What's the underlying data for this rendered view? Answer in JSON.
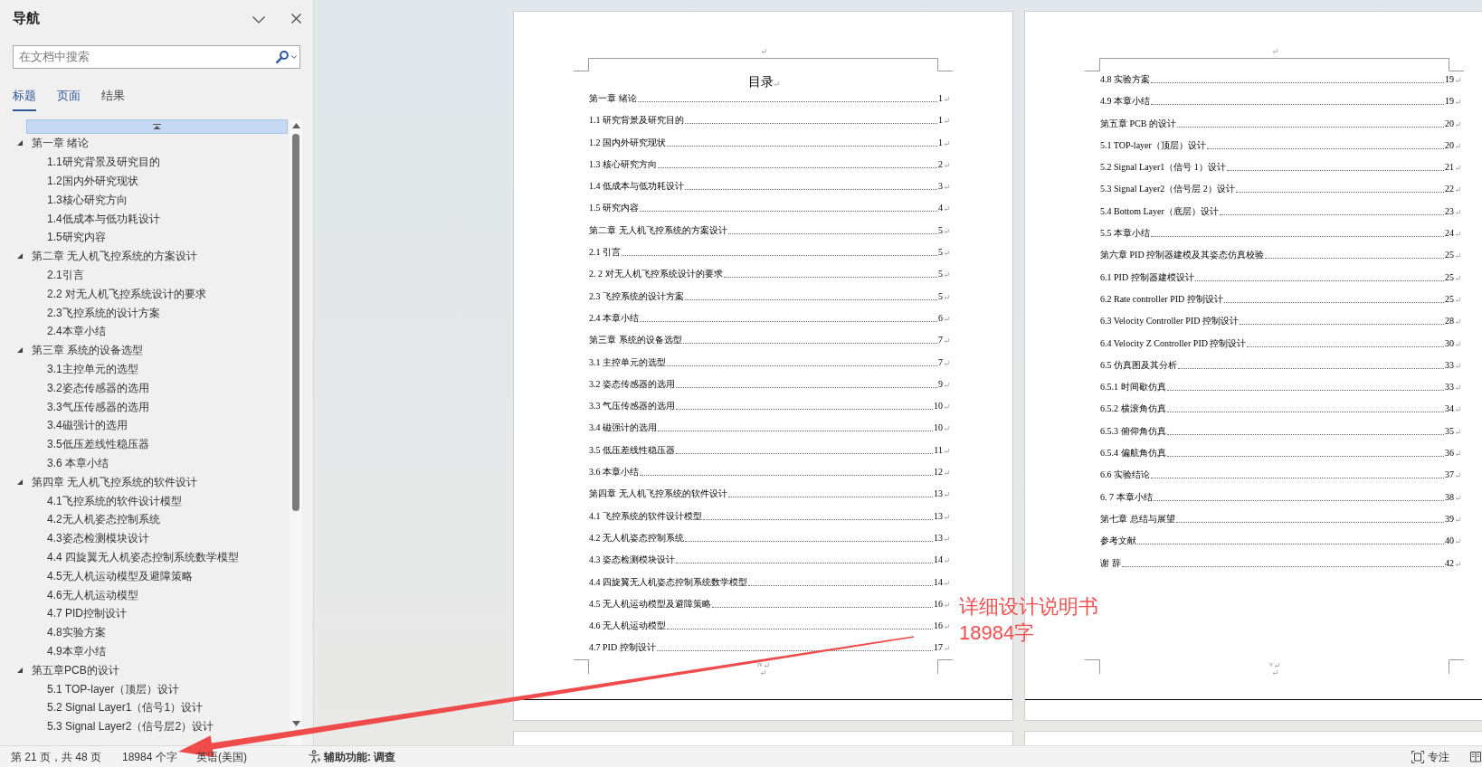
{
  "navigation": {
    "title": "导航",
    "search": {
      "placeholder": "在文档中搜索"
    },
    "tabs": [
      {
        "label": "标题",
        "selected": true,
        "disabled": false
      },
      {
        "label": "页面",
        "selected": false,
        "disabled": false
      },
      {
        "label": "结果",
        "selected": false,
        "disabled": true
      }
    ],
    "headings": [
      {
        "label": "第一章 绪论",
        "expanded": true,
        "children": [
          {
            "label": "1.1研究背景及研究目的"
          },
          {
            "label": "1.2国内外研究现状"
          },
          {
            "label": "1.3核心研究方向"
          },
          {
            "label": "1.4低成本与低功耗设计"
          },
          {
            "label": "1.5研究内容"
          }
        ]
      },
      {
        "label": "第二章 无人机飞控系统的方案设计",
        "expanded": true,
        "children": [
          {
            "label": "2.1引言"
          },
          {
            "label": "2.2 对无人机飞控系统设计的要求"
          },
          {
            "label": "2.3飞控系统的设计方案"
          },
          {
            "label": "2.4本章小结"
          }
        ]
      },
      {
        "label": "第三章 系统的设备选型",
        "expanded": true,
        "children": [
          {
            "label": "3.1主控单元的选型"
          },
          {
            "label": "3.2姿态传感器的选用"
          },
          {
            "label": "3.3气压传感器的选用"
          },
          {
            "label": "3.4磁强计的选用"
          },
          {
            "label": "3.5低压差线性稳压器"
          },
          {
            "label": "3.6 本章小结"
          }
        ]
      },
      {
        "label": "第四章 无人机飞控系统的软件设计",
        "expanded": true,
        "children": [
          {
            "label": "4.1飞控系统的软件设计模型"
          },
          {
            "label": "4.2无人机姿态控制系统"
          },
          {
            "label": "4.3姿态检测模块设计"
          },
          {
            "label": "4.4 四旋翼无人机姿态控制系统数学模型"
          },
          {
            "label": "4.5无人机运动模型及避障策略"
          },
          {
            "label": "4.6无人机运动模型"
          },
          {
            "label": "4.7 PID控制设计"
          },
          {
            "label": "4.8实验方案"
          },
          {
            "label": "4.9本章小结"
          }
        ]
      },
      {
        "label": "第五章PCB的设计",
        "expanded": true,
        "children": [
          {
            "label": "5.1 TOP-layer（顶层）设计"
          },
          {
            "label": "5.2 Signal Layer1（信号1）设计"
          },
          {
            "label": "5.3 Signal Layer2（信号层2）设计"
          }
        ]
      }
    ]
  },
  "document": {
    "pages": [
      {
        "title": "目录",
        "entries": [
          {
            "title": "第一章 绪论",
            "page": "1"
          },
          {
            "title": "1.1 研究背景及研究目的",
            "page": "1"
          },
          {
            "title": "1.2 国内外研究现状",
            "page": "1"
          },
          {
            "title": "1.3 核心研究方向",
            "page": "2"
          },
          {
            "title": "1.4 低成本与低功耗设计",
            "page": "3"
          },
          {
            "title": "1.5 研究内容",
            "page": "4"
          },
          {
            "title": "第二章 无人机飞控系统的方案设计",
            "page": "5"
          },
          {
            "title": "2.1 引言",
            "page": "5"
          },
          {
            "title": "2. 2 对无人机飞控系统设计的要求",
            "page": "5"
          },
          {
            "title": "2.3 飞控系统的设计方案",
            "page": "5"
          },
          {
            "title": "2.4 本章小结",
            "page": "6"
          },
          {
            "title": "第三章 系统的设备选型",
            "page": "7"
          },
          {
            "title": "3.1 主控单元的选型",
            "page": "7"
          },
          {
            "title": "3.2 姿态传感器的选用",
            "page": "9"
          },
          {
            "title": "3.3 气压传感器的选用",
            "page": "10"
          },
          {
            "title": "3.4 磁强计的选用",
            "page": "10"
          },
          {
            "title": "3.5 低压差线性稳压器",
            "page": "11"
          },
          {
            "title": "3.6 本章小结",
            "page": "12"
          },
          {
            "title": "第四章 无人机飞控系统的软件设计",
            "page": "13"
          },
          {
            "title": "4.1 飞控系统的软件设计模型",
            "page": "13"
          },
          {
            "title": "4.2 无人机姿态控制系统",
            "page": "13"
          },
          {
            "title": "4.3 姿态检测模块设计",
            "page": "14"
          },
          {
            "title": "4.4 四旋翼无人机姿态控制系统数学模型",
            "page": "14"
          },
          {
            "title": "4.5 无人机运动模型及避障策略",
            "page": "16"
          },
          {
            "title": "4.6 无人机运动模型",
            "page": "16"
          },
          {
            "title": "4.7 PID 控制设计",
            "page": "17"
          }
        ],
        "page_number": "iv"
      },
      {
        "entries": [
          {
            "title": "4.8 实验方案",
            "page": "19"
          },
          {
            "title": "4.9 本章小结",
            "page": "19"
          },
          {
            "title": "第五章 PCB 的设计",
            "page": "20"
          },
          {
            "title": "5.1 TOP-layer（顶层）设计",
            "page": "20"
          },
          {
            "title": "5.2 Signal Layer1（信号 1）设计",
            "page": "21"
          },
          {
            "title": "5.3 Signal Layer2（信号层 2）设计",
            "page": "22"
          },
          {
            "title": "5.4 Bottom Layer（底层）设计",
            "page": "23"
          },
          {
            "title": "5.5 本章小结",
            "page": "24"
          },
          {
            "title": "第六章 PID 控制器建模及其姿态仿真校验",
            "page": "25"
          },
          {
            "title": "6.1 PID 控制器建模设计",
            "page": "25"
          },
          {
            "title": "6.2 Rate controller PID 控制设计",
            "page": "25"
          },
          {
            "title": "6.3 Velocity Controller PID 控制设计",
            "page": "28"
          },
          {
            "title": "6.4 Velocity Z Controller PID 控制设计",
            "page": "30"
          },
          {
            "title": "6.5 仿真图及其分析",
            "page": "33"
          },
          {
            "title": "6.5.1 时间歇仿真",
            "page": "33"
          },
          {
            "title": "6.5.2 横滚角仿真",
            "page": "34"
          },
          {
            "title": "6.5.3 俯仰角仿真",
            "page": "35"
          },
          {
            "title": "6.5.4 偏航角仿真",
            "page": "36"
          },
          {
            "title": "6.6 实验结论",
            "page": "37"
          },
          {
            "title": "6. 7 本章小结",
            "page": "38"
          },
          {
            "title": "第七章 总结与展望",
            "page": "39"
          },
          {
            "title": "参考文献",
            "page": "40"
          },
          {
            "title": "谢 辞",
            "page": "42"
          }
        ],
        "page_number": "v"
      }
    ]
  },
  "annotation": {
    "lines": [
      "详细设计说明书",
      "18984字"
    ]
  },
  "status_bar": {
    "page_info": "第 21 页，共 48 页",
    "word_count": "18984 个字",
    "language": "英语(美国)",
    "accessibility": "辅助功能: 调查",
    "focus": "专注"
  }
}
